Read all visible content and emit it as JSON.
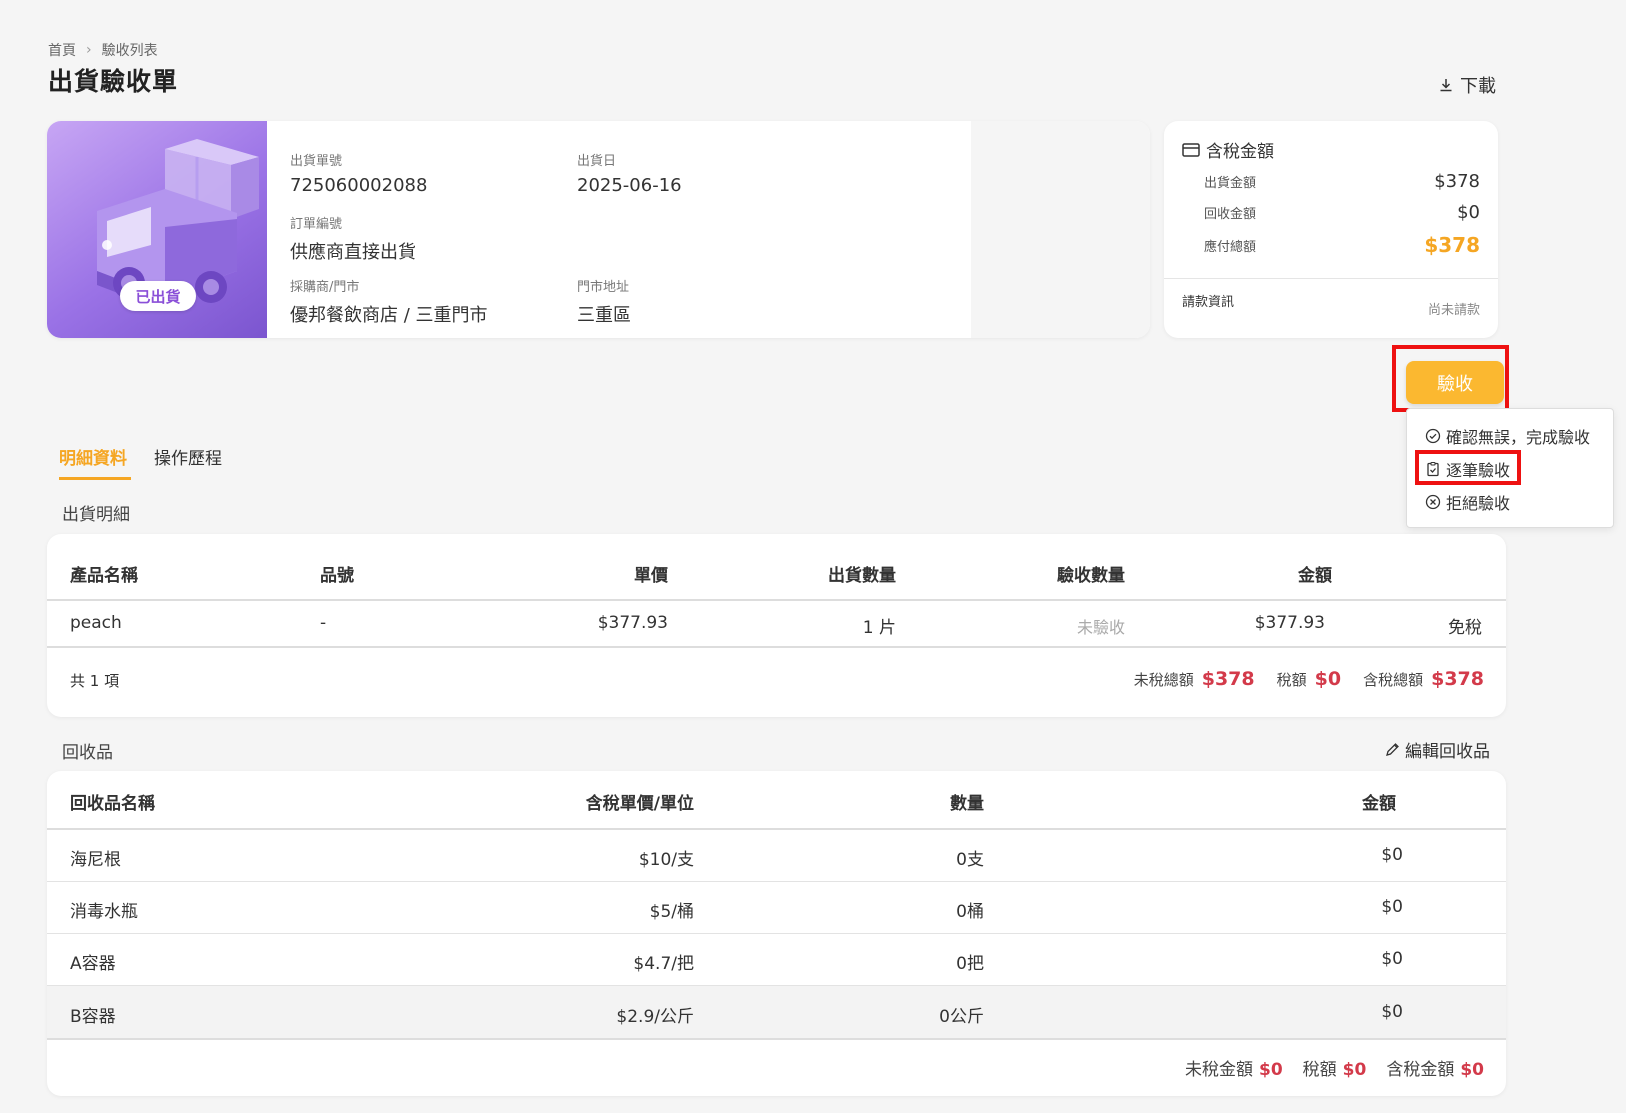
{
  "breadcrumb": {
    "home": "首頁",
    "current": "驗收列表"
  },
  "page_title": "出貨驗收單",
  "download_label": "下載",
  "info": {
    "status_badge": "已出貨",
    "shipment_no_label": "出貨單號",
    "shipment_no": "725060002088",
    "ship_date_label": "出貨日",
    "ship_date": "2025-06-16",
    "order_no_label": "訂單編號",
    "order_no": "供應商直接出貨",
    "buyer_label": "採購商/門市",
    "buyer": "優邦餐飲商店 / 三重門市",
    "address_label": "門市地址",
    "address": "三重區"
  },
  "amount": {
    "title": "含稅金額",
    "ship_amount_label": "出貨金額",
    "ship_amount": "$378",
    "recycle_amount_label": "回收金額",
    "recycle_amount": "$0",
    "payable_label": "應付總額",
    "payable": "$378",
    "billing_label": "請款資訊",
    "billing_status": "尚未請款"
  },
  "accept": {
    "button": "驗收",
    "menu": [
      "確認無誤，完成驗收",
      "逐筆驗收",
      "拒絕驗收"
    ]
  },
  "tabs": [
    "明細資料",
    "操作歷程"
  ],
  "shipment_section": {
    "title": "出貨明細",
    "headers": [
      "產品名稱",
      "品號",
      "單價",
      "出貨數量",
      "驗收數量",
      "金額"
    ],
    "rows": [
      {
        "name": "peach",
        "sku": "-",
        "price": "$377.93",
        "qty": "1 片",
        "accepted": "未驗收",
        "amount": "$377.93",
        "tax": "免稅"
      }
    ],
    "count": "共 1 項",
    "untaxed_label": "未稅總額",
    "untaxed": "$378",
    "tax_label": "稅額",
    "tax": "$0",
    "total_label": "含稅總額",
    "total": "$378"
  },
  "recycle_section": {
    "title": "回收品",
    "edit_label": "編輯回收品",
    "headers": [
      "回收品名稱",
      "含稅單價/單位",
      "數量",
      "金額"
    ],
    "rows": [
      {
        "name": "海尼根",
        "price": "$10/支",
        "qty": "0支",
        "amount": "$0"
      },
      {
        "name": "消毒水瓶",
        "price": "$5/桶",
        "qty": "0桶",
        "amount": "$0"
      },
      {
        "name": "A容器",
        "price": "$4.7/把",
        "qty": "0把",
        "amount": "$0"
      },
      {
        "name": "B容器",
        "price": "$2.9/公斤",
        "qty": "0公斤",
        "amount": "$0"
      }
    ],
    "untaxed_label": "未稅金額",
    "untaxed": "$0",
    "tax_label": "稅額",
    "tax": "$0",
    "total_label": "含稅金額",
    "total": "$0"
  },
  "colors": {
    "accent": "#f5a623",
    "button": "#fbb830",
    "highlight": "#ee1111",
    "price_red": "#d33a4a",
    "hero": "#9a72e6"
  }
}
